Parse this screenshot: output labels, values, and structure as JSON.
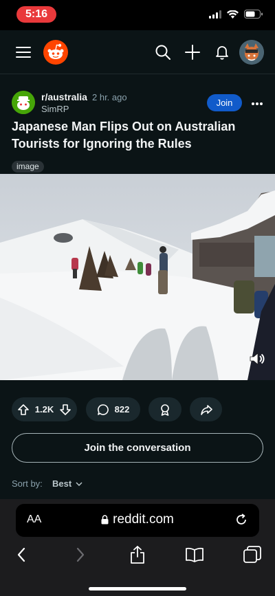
{
  "status_bar": {
    "time": "5:16"
  },
  "header": {
    "icons": [
      "menu-icon",
      "reddit-logo",
      "search-icon",
      "plus-icon",
      "bell-icon",
      "avatar"
    ]
  },
  "post": {
    "subreddit": "r/australia",
    "age": "2 hr. ago",
    "author": "SimRP",
    "join_label": "Join",
    "title": "Japanese Man Flips Out on Australian Tourists for Ignoring the Rules",
    "flair": "image",
    "upvotes": "1.2K",
    "comments": "822",
    "conversation_label": "Join the conversation",
    "sort_label": "Sort by:",
    "sort_value": "Best"
  },
  "browser": {
    "aa_label": "AA",
    "domain": "reddit.com"
  },
  "colors": {
    "accent": "#ff4500",
    "join_button": "#115bca",
    "time_pill": "#e9393b",
    "background": "#0b1416"
  }
}
